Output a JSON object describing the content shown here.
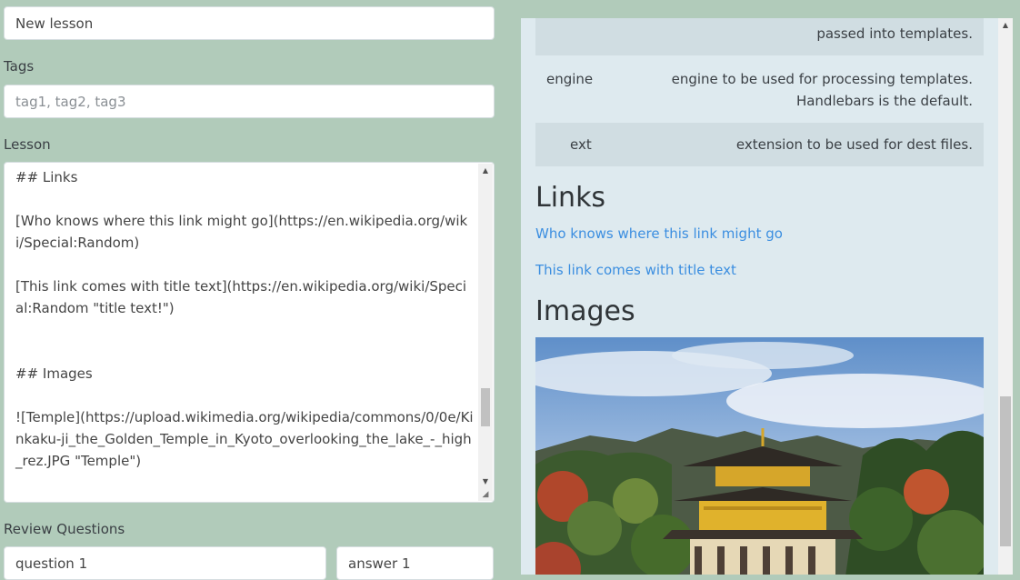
{
  "form": {
    "title_value": "New lesson",
    "tags_label": "Tags",
    "tags_placeholder": "tag1, tag2, tag3",
    "lesson_label": "Lesson",
    "lesson_text": "## Links\n\n[Who knows where this link might go](https://en.wikipedia.org/wiki/Special:Random)\n\n[This link comes with title text](https://en.wikipedia.org/wiki/Special:Random \"title text!\")\n\n\n## Images\n\n![Temple](https://upload.wikimedia.org/wikipedia/commons/0/0e/Kinkaku-ji_the_Golden_Temple_in_Kyoto_overlooking_the_lake_-_high_rez.JPG \"Temple\")",
    "review_label": "Review Questions",
    "question_value": "question 1",
    "answer_value": "answer 1"
  },
  "preview": {
    "table_rows": [
      {
        "name": "",
        "desc_line1": "passed into templates.",
        "desc_line2": ""
      },
      {
        "name": "engine",
        "desc_line1": "engine to be used for processing templates.",
        "desc_line2": "Handlebars is the default."
      },
      {
        "name": "ext",
        "desc_line1": "extension to be used for dest files.",
        "desc_line2": ""
      }
    ],
    "links_heading": "Links",
    "link1": "Who knows where this link might go",
    "link2": "This link comes with title text",
    "images_heading": "Images"
  },
  "colors": {
    "page_bg": "#b1cbba",
    "preview_bg": "#deeaef",
    "link": "#3b8ee0"
  }
}
